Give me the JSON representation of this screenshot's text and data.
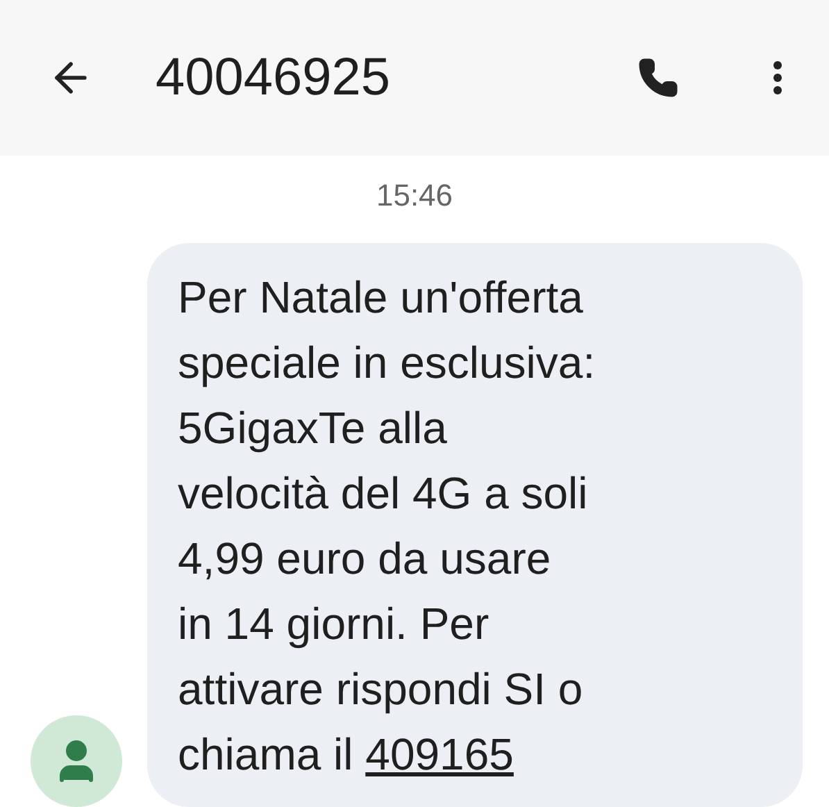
{
  "header": {
    "title": "40046925"
  },
  "timestamp": "15:46",
  "message": {
    "text": "Per Natale un'offerta\nspeciale in esclusiva:\n5GigaxTe alla\nvelocità del 4G a soli\n4,99 euro da usare\nin 14 giorni. Per\nattivare rispondi SI o\nchiama il ",
    "link": "409165"
  }
}
